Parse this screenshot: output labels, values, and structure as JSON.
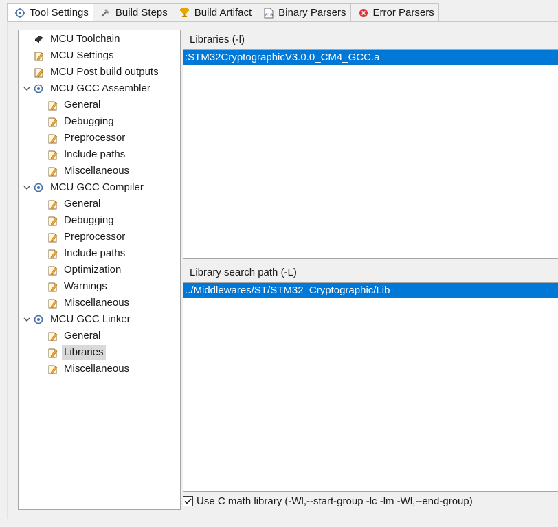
{
  "tabs": [
    {
      "label": "Tool Settings",
      "icon": "settings-icon"
    },
    {
      "label": "Build Steps",
      "icon": "build-steps-icon"
    },
    {
      "label": "Build Artifact",
      "icon": "trophy-icon"
    },
    {
      "label": "Binary Parsers",
      "icon": "binary-icon"
    },
    {
      "label": "Error Parsers",
      "icon": "error-icon"
    }
  ],
  "tree": {
    "toolchain": "MCU Toolchain",
    "settings": "MCU Settings",
    "post_build": "MCU Post build outputs",
    "assembler": {
      "label": "MCU GCC Assembler",
      "children": [
        "General",
        "Debugging",
        "Preprocessor",
        "Include paths",
        "Miscellaneous"
      ]
    },
    "compiler": {
      "label": "MCU GCC Compiler",
      "children": [
        "General",
        "Debugging",
        "Preprocessor",
        "Include paths",
        "Optimization",
        "Warnings",
        "Miscellaneous"
      ]
    },
    "linker": {
      "label": "MCU GCC Linker",
      "children": [
        "General",
        "Libraries",
        "Miscellaneous"
      ],
      "selected": "Libraries"
    }
  },
  "libraries": {
    "title": "Libraries (-l)",
    "items": [
      ":STM32CryptographicV3.0.0_CM4_GCC.a"
    ]
  },
  "search_path": {
    "title": "Library search path (-L)",
    "items": [
      "../Middlewares/ST/STM32_Cryptographic/Lib"
    ]
  },
  "math_lib": {
    "label": "Use C math library (-Wl,--start-group -lc -lm -Wl,--end-group)",
    "checked": true
  }
}
